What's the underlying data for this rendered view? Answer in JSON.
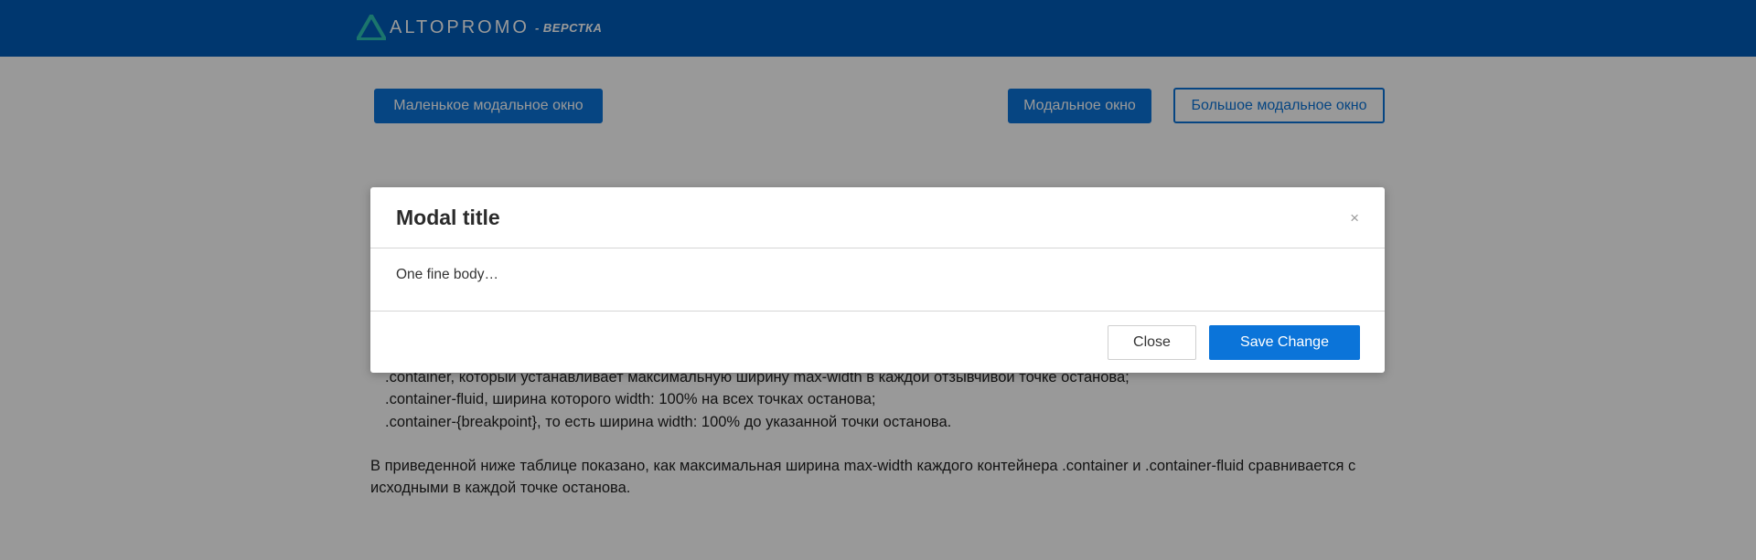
{
  "header": {
    "logo_text": "ALTOPROMO",
    "logo_sub": "- ВЕРСТКА",
    "logo_icon": "triangle-logo-icon"
  },
  "buttons": {
    "small_modal": "Маленькое модальное окно",
    "modal": "Модальное окно",
    "large_modal": "Большое модальное окно"
  },
  "content": {
    "list_items": [
      ".container, который устанавливает максимальную ширину max-width в каждой отзывчивой точке останова;",
      ".container-fluid, ширина которого width: 100% на всех точках останова;",
      ".container-{breakpoint}, то есть ширина width: 100% до указанной точки останова."
    ],
    "paragraph_line1": "В приведенной ниже таблице показано, как максимальная ширина max-width каждого контейнера .container и .container-fluid сравнивается с",
    "paragraph_line2": "исходными в каждой точке останова."
  },
  "modal": {
    "title": "Modal title",
    "close_symbol": "×",
    "body": "One fine body…",
    "close_label": "Close",
    "save_label": "Save Change"
  },
  "colors": {
    "brand": "#005cb9",
    "accent": "#0b74d9",
    "overlay": "rgba(0,0,0,0.40)"
  }
}
